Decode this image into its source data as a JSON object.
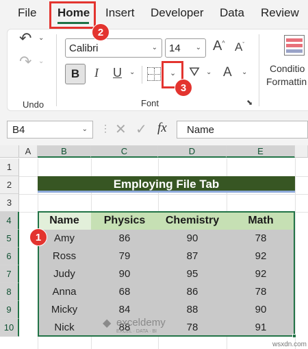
{
  "tabs": [
    "File",
    "Home",
    "Insert",
    "Developer",
    "Data",
    "Review"
  ],
  "ribbon": {
    "undo_label": "Undo",
    "font_group_label": "Font",
    "font_name": "Calibri",
    "font_size": "14",
    "bold": "B",
    "italic": "I",
    "underline": "U",
    "font_color_glyph": "A",
    "conditional": "Conditio",
    "formatting": "Formattin"
  },
  "formula_bar": {
    "name_box": "B4",
    "fx": "fx",
    "content": "Name"
  },
  "columns": [
    "A",
    "B",
    "C",
    "D",
    "E"
  ],
  "rows": [
    "1",
    "2",
    "3",
    "4",
    "5",
    "6",
    "7",
    "8",
    "9",
    "10"
  ],
  "sheet": {
    "title": "Employing File Tab",
    "headers": [
      "Name",
      "Physics",
      "Chemistry",
      "Math"
    ],
    "data": [
      [
        "Amy",
        "86",
        "90",
        "78"
      ],
      [
        "Ross",
        "79",
        "87",
        "92"
      ],
      [
        "Judy",
        "90",
        "95",
        "92"
      ],
      [
        "Anna",
        "68",
        "86",
        "78"
      ],
      [
        "Micky",
        "84",
        "88",
        "90"
      ],
      [
        "Nick",
        "88",
        "78",
        "91"
      ]
    ]
  },
  "steps": [
    "1",
    "2",
    "3"
  ],
  "watermark": {
    "name": "exceldemy",
    "tagline": "EXCEL · DATA · BI",
    "site": "wsxdn.com"
  },
  "colors": {
    "title_fill": "#375623",
    "header_fill": "#c6e0b4",
    "data_fill": "#c9c9c9",
    "marker": "#e3342f",
    "accent": "#217346"
  }
}
